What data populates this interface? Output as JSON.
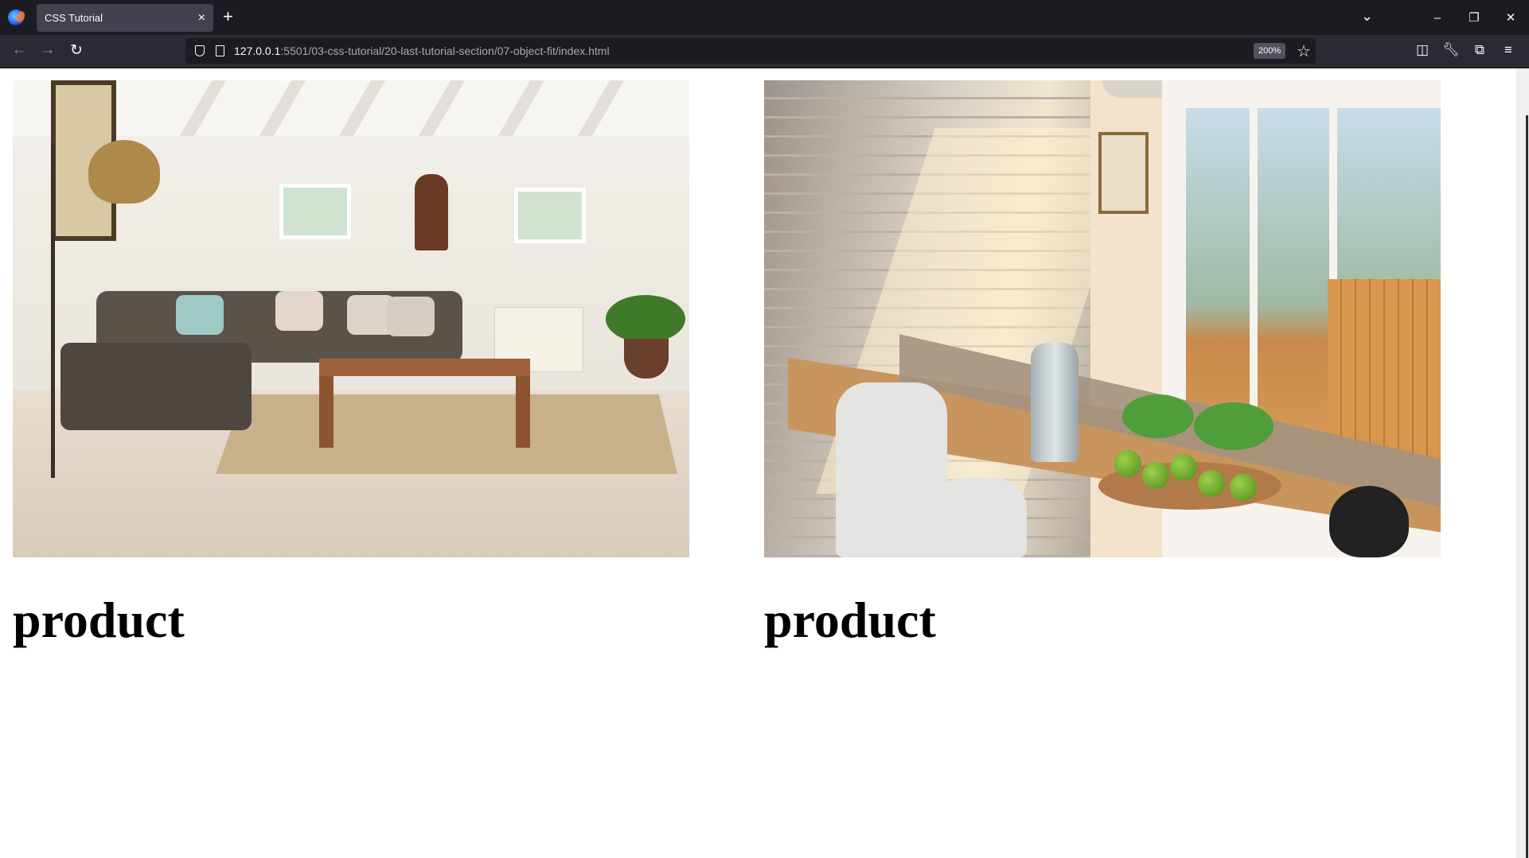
{
  "browser": {
    "tab_title": "CSS Tutorial",
    "tab_close_glyph": "×",
    "new_tab_glyph": "+",
    "url_host": "127.0.0.1",
    "url_rest": ":5501/03-css-tutorial/20-last-tutorial-section/07-object-fit/index.html",
    "zoom_level": "200%",
    "icons": [
      "firefox-logo",
      "back-arrow-icon",
      "forward-arrow-icon",
      "reload-icon",
      "shield-icon",
      "page-icon",
      "star-icon",
      "pocket-icon",
      "wrench-icon",
      "extensions-icon",
      "menu-icon",
      "tabs-list-icon",
      "minimize-icon",
      "restore-icon",
      "close-window-icon"
    ],
    "colors": {
      "chrome_dark": "#1c1b22",
      "toolbar": "#2b2a33",
      "tab_active": "#42414d",
      "text": "#fbfbfe"
    }
  },
  "page": {
    "cards": [
      {
        "image_alt": "living room",
        "title": "product"
      },
      {
        "image_alt": "dining table",
        "title": "product"
      }
    ]
  }
}
